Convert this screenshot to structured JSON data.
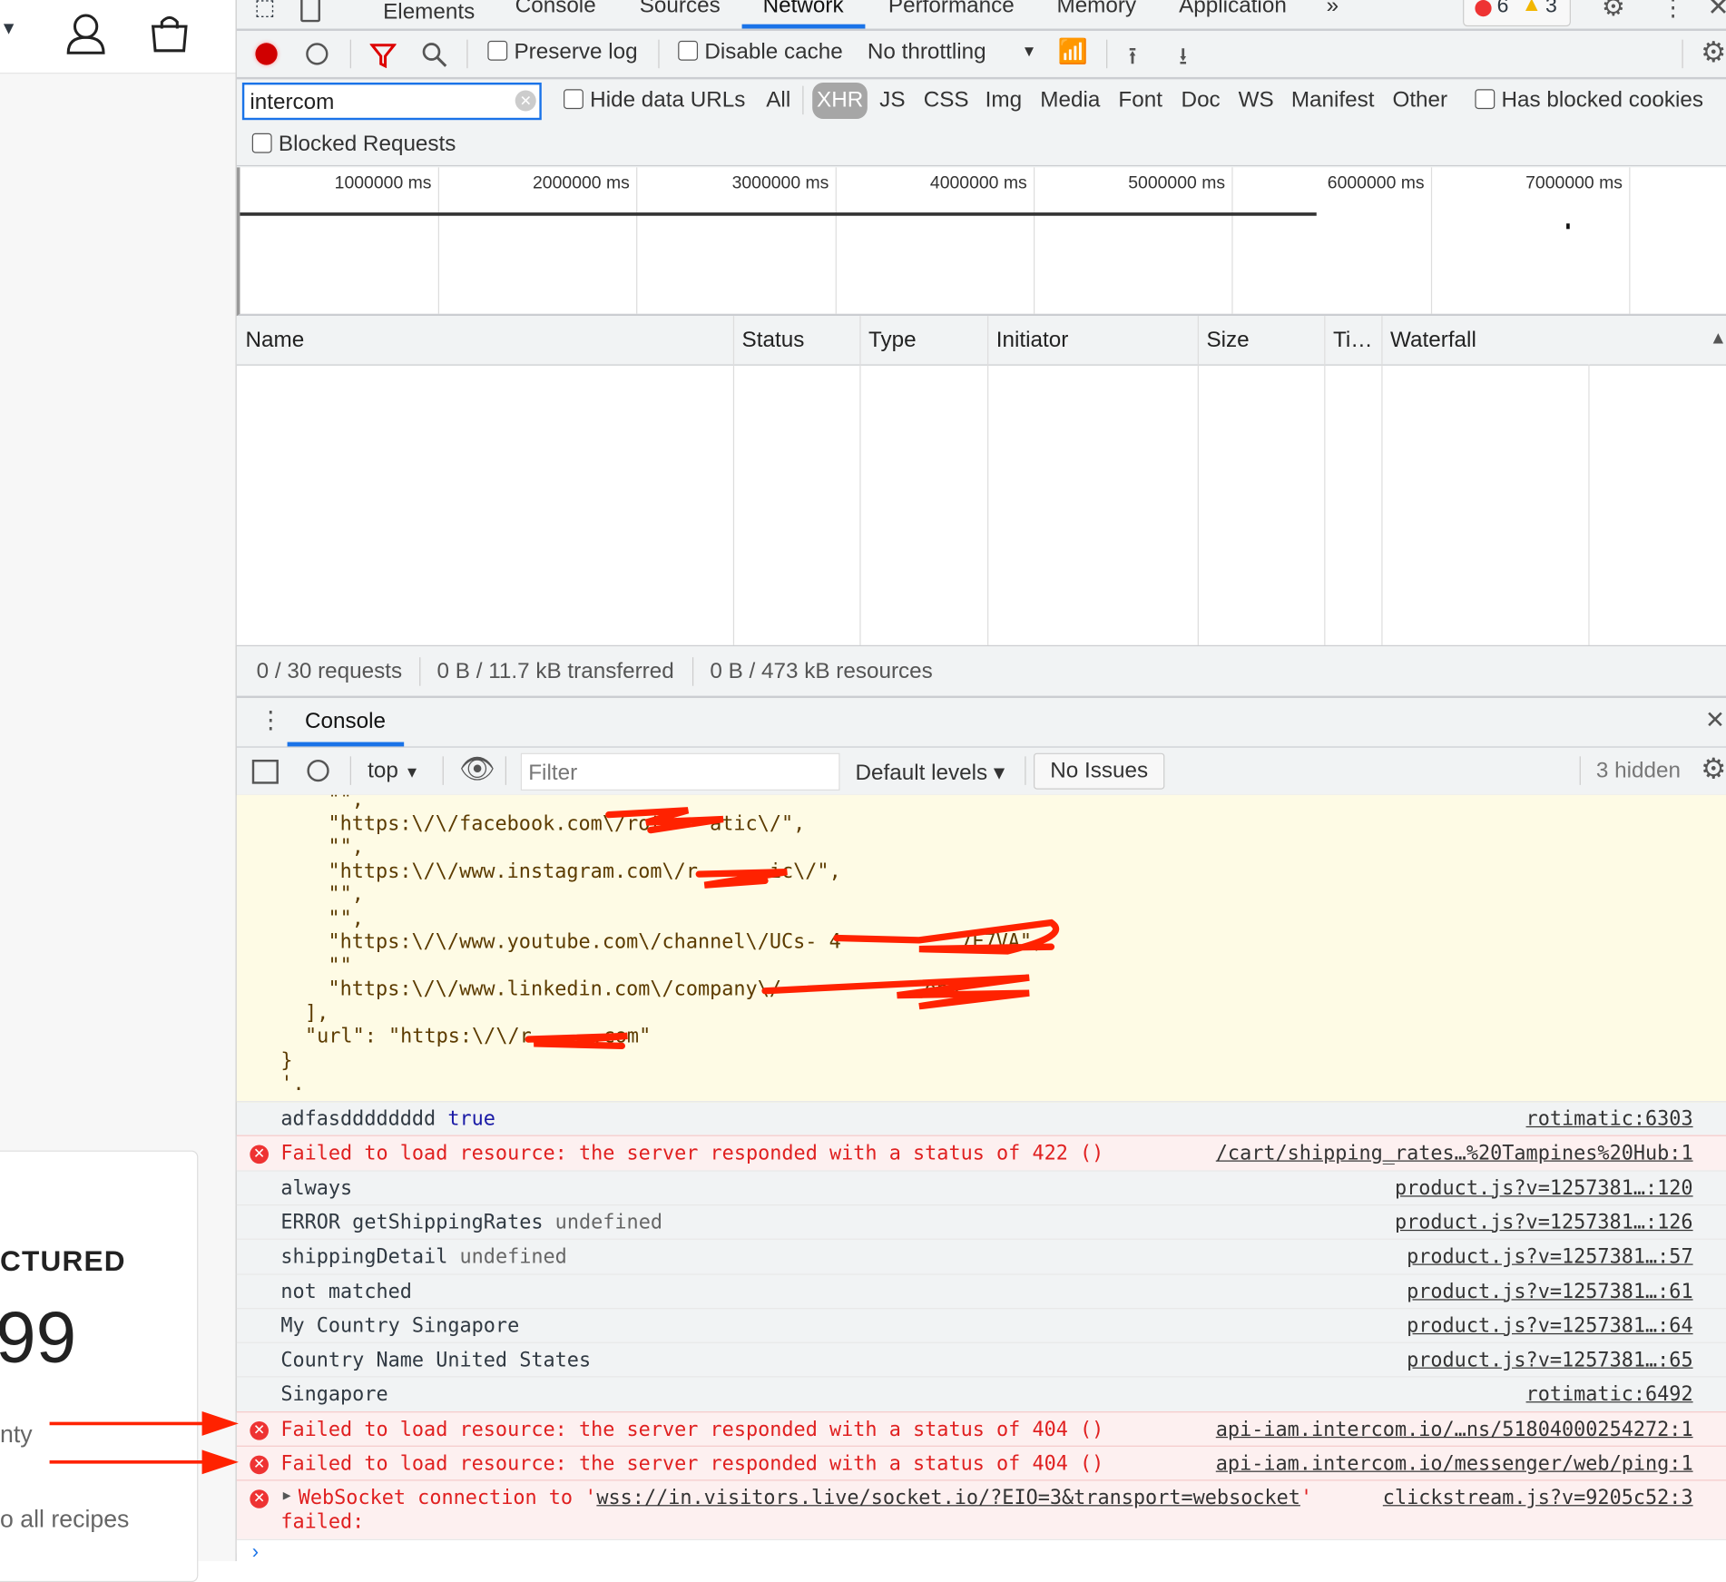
{
  "page": {
    "account_icon": "user-icon",
    "bag_icon": "shopping-bag-icon",
    "featured": "CTURED",
    "price": "99",
    "qty_label": "nty",
    "back_link": "o all recipes"
  },
  "devtools": {
    "tabs": [
      "Elements",
      "Console",
      "Sources",
      "Network",
      "Performance",
      "Memory",
      "Application"
    ],
    "active_tab": "Network",
    "more": "»",
    "errors": "6",
    "warnings": "3",
    "toolbar": {
      "preserve_log": "Preserve log",
      "disable_cache": "Disable cache",
      "throttling": "No throttling"
    },
    "filter": {
      "value": "intercom",
      "hide_data_urls": "Hide data URLs",
      "types": [
        "All",
        "XHR",
        "JS",
        "CSS",
        "Img",
        "Media",
        "Font",
        "Doc",
        "WS",
        "Manifest",
        "Other"
      ],
      "active_type": "XHR",
      "has_blocked_cookies": "Has blocked cookies",
      "blocked_requests": "Blocked Requests"
    },
    "timeline": [
      "1000000 ms",
      "2000000 ms",
      "3000000 ms",
      "4000000 ms",
      "5000000 ms",
      "6000000 ms",
      "7000000 ms"
    ],
    "columns": [
      "Name",
      "Status",
      "Type",
      "Initiator",
      "Size",
      "Ti…",
      "Waterfall"
    ],
    "status": {
      "requests": "0 / 30 requests",
      "transferred": "0 B / 11.7 kB transferred",
      "resources": "0 B / 473 kB resources"
    },
    "drawer_tab": "Console",
    "console_toolbar": {
      "context": "top",
      "filter_placeholder": "Filter",
      "levels": "Default levels ▾",
      "issues": "No Issues",
      "hidden": "3 hidden"
    },
    "json_lines": [
      "\"\",",
      "\"https:\\/\\/facebook.com\\/rot    atic\\/\",",
      "\"\",",
      "\"https:\\/\\/www.instagram.com\\/r      ic\\/\",",
      "\"\",",
      "\"\",",
      "\"https:\\/\\/www.youtube.com\\/channel\\/UCs- 4          7E7VA\",",
      "\"\"",
      "\"https:\\/\\/www.linkedin.com\\/company\\/            ons\"",
      "],",
      "\"url\": \"https:\\/\\/r     .com\"",
      "}",
      "'."
    ],
    "logs": [
      {
        "msg": "adfasdddddddd",
        "val": "true",
        "src": "rotimatic:6303",
        "level": "log"
      },
      {
        "msg": "Failed to load resource: the server responded with a status of 422 ()",
        "src": "/cart/shipping_rates…%20Tampines%20Hub:1",
        "level": "error"
      },
      {
        "msg": "always",
        "src": "product.js?v=1257381…:120",
        "level": "log"
      },
      {
        "msg": "ERROR getShippingRates",
        "val": "undefined",
        "src": "product.js?v=1257381…:126",
        "level": "log"
      },
      {
        "msg": "shippingDetail",
        "val": "undefined",
        "src": "product.js?v=1257381…:57",
        "level": "log"
      },
      {
        "msg": "not matched",
        "src": "product.js?v=1257381…:61",
        "level": "log"
      },
      {
        "msg": "My Country Singapore",
        "src": "product.js?v=1257381…:64",
        "level": "log"
      },
      {
        "msg": "Country Name United States",
        "src": "product.js?v=1257381…:65",
        "level": "log"
      },
      {
        "msg": "Singapore",
        "src": "rotimatic:6492",
        "level": "log"
      },
      {
        "msg": "Failed to load resource: the server responded with a status of 404 ()",
        "src": "api-iam.intercom.io/…ns/51804000254272:1",
        "level": "error"
      },
      {
        "msg": "Failed to load resource: the server responded with a status of 404 ()",
        "src": "api-iam.intercom.io/messenger/web/ping:1",
        "level": "error"
      },
      {
        "msg": "WebSocket connection to '",
        "url": "wss://in.visitors.live/socket.io/?EIO=3&transport=websocket",
        "msg2": "'",
        "msg3": "failed:",
        "src": "clickstream.js?v=9205c52:3",
        "level": "error"
      }
    ],
    "colors": {
      "accent": "#1a73e8",
      "error": "#e02020",
      "record": "#d00000",
      "annotation": "#ff2200"
    }
  }
}
